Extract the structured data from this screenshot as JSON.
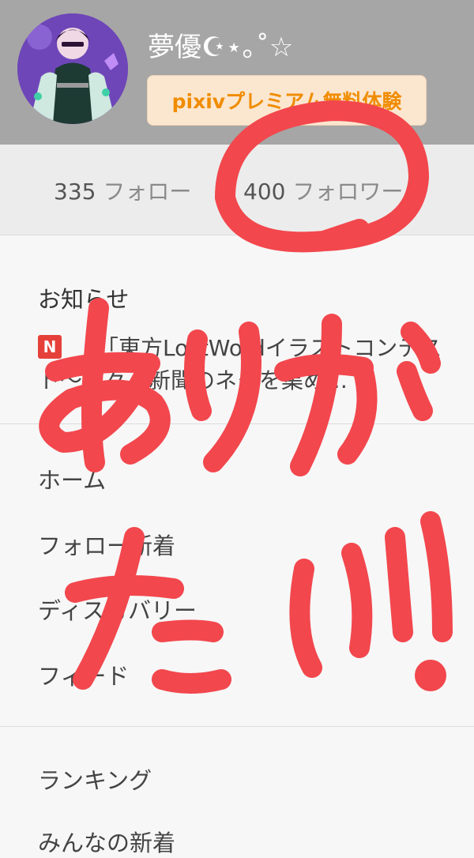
{
  "profile": {
    "username": "夢優☪︎⋆｡˚☆",
    "premium_button": "pixivプレミアム無料体験"
  },
  "stats": {
    "follow_count": "335",
    "follow_label": "フォロー",
    "follower_count": "400",
    "follower_label": "フォロワー"
  },
  "notices": {
    "title": "お知らせ",
    "badge": "N",
    "text": "「東方LostWordイラストコンテスト〜文々。新聞のネタを集め…"
  },
  "menu": {
    "home": "ホーム",
    "following_new": "フォロー新着",
    "discovery": "ディスカバリー",
    "feed": "フィード",
    "ranking": "ランキング",
    "everyone_new": "みんなの新着"
  },
  "overlay": {
    "handwritten_text": "ありがたい!!",
    "color": "#f2474d"
  },
  "colors": {
    "header_bg": "#a6a6a6",
    "premium_text": "#f08c00",
    "premium_bg": "#fbe6cf",
    "notice_badge": "#e6403a"
  }
}
